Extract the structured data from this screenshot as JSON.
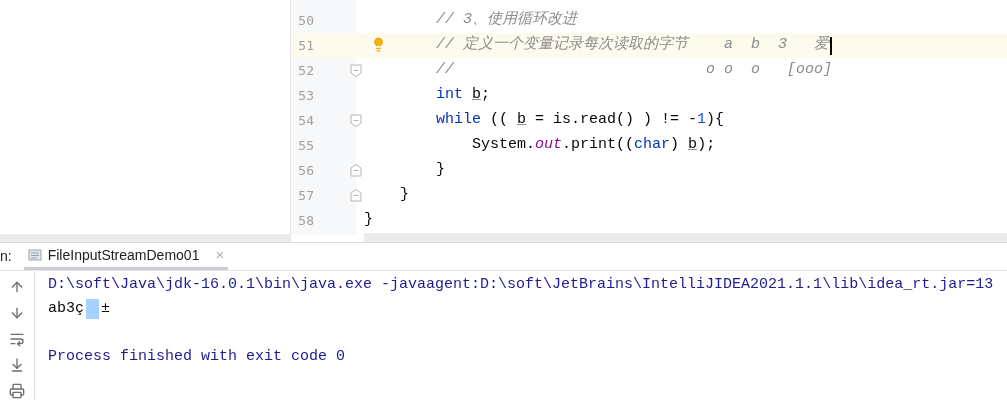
{
  "editor": {
    "lines": [
      {
        "number": "50",
        "highlighted": false,
        "bulb": false,
        "fold_start": false,
        "fold_end": false,
        "caret": false,
        "tokens": [
          {
            "text": "        // 3、使用循环改进",
            "kind": "comment"
          }
        ]
      },
      {
        "number": "51",
        "highlighted": true,
        "bulb": true,
        "fold_start": false,
        "fold_end": false,
        "caret": true,
        "tokens": [
          {
            "text": "        // 定义一个变量记录每次读取的字节    a  b  3   爱",
            "kind": "comment"
          }
        ]
      },
      {
        "number": "52",
        "highlighted": false,
        "bulb": false,
        "fold_start": true,
        "fold_end": false,
        "caret": false,
        "tokens": [
          {
            "text": "        //                            o o  o   [ooo]",
            "kind": "comment"
          }
        ]
      },
      {
        "number": "53",
        "highlighted": false,
        "bulb": false,
        "fold_start": false,
        "fold_end": false,
        "caret": false,
        "tokens": [
          {
            "text": "        int ",
            "kind": "keyword"
          },
          {
            "text": "b",
            "kind": "reassigned"
          },
          {
            "text": ";",
            "kind": "plain"
          }
        ]
      },
      {
        "number": "54",
        "highlighted": false,
        "bulb": false,
        "fold_start": true,
        "fold_end": false,
        "caret": false,
        "tokens": [
          {
            "text": "        while",
            "kind": "keyword"
          },
          {
            "text": " (( ",
            "kind": "plain"
          },
          {
            "text": "b",
            "kind": "reassigned"
          },
          {
            "text": " = is.read() ) != -",
            "kind": "plain"
          },
          {
            "text": "1",
            "kind": "number"
          },
          {
            "text": "){",
            "kind": "plain"
          }
        ]
      },
      {
        "number": "55",
        "highlighted": false,
        "bulb": false,
        "fold_start": false,
        "fold_end": false,
        "caret": false,
        "tokens": [
          {
            "text": "            System.",
            "kind": "plain"
          },
          {
            "text": "out",
            "kind": "static"
          },
          {
            "text": ".print((",
            "kind": "plain"
          },
          {
            "text": "char",
            "kind": "keyword"
          },
          {
            "text": ") ",
            "kind": "plain"
          },
          {
            "text": "b",
            "kind": "reassigned"
          },
          {
            "text": ");",
            "kind": "plain"
          }
        ]
      },
      {
        "number": "56",
        "highlighted": false,
        "bulb": false,
        "fold_start": false,
        "fold_end": true,
        "caret": false,
        "tokens": [
          {
            "text": "        }",
            "kind": "plain"
          }
        ]
      },
      {
        "number": "57",
        "highlighted": false,
        "bulb": false,
        "fold_start": false,
        "fold_end": true,
        "caret": false,
        "tokens": [
          {
            "text": "    }",
            "kind": "plain"
          }
        ]
      },
      {
        "number": "58",
        "highlighted": false,
        "bulb": false,
        "fold_start": false,
        "fold_end": false,
        "caret": false,
        "tokens": [
          {
            "text": "}",
            "kind": "plain"
          }
        ]
      }
    ]
  },
  "run_panel": {
    "label": "n:",
    "tab": {
      "title": "FileInputStreamDemo01",
      "close": "×",
      "selected": true
    },
    "console": [
      {
        "kind": "command",
        "segments": [
          {
            "kind": "text",
            "text": "D:\\soft\\Java\\jdk-16.0.1\\bin\\java.exe -javaagent:D:\\soft\\JetBrains\\IntelliJIDEA2021.1.1\\lib\\idea_rt.jar=13"
          }
        ]
      },
      {
        "kind": "output",
        "segments": [
          {
            "kind": "text",
            "text": "ab3ç"
          },
          {
            "kind": "selection"
          },
          {
            "kind": "text",
            "text": "±"
          }
        ]
      },
      {
        "kind": "exit",
        "segments": [
          {
            "kind": "text",
            "text": "Process finished with exit code 0"
          }
        ]
      }
    ]
  }
}
